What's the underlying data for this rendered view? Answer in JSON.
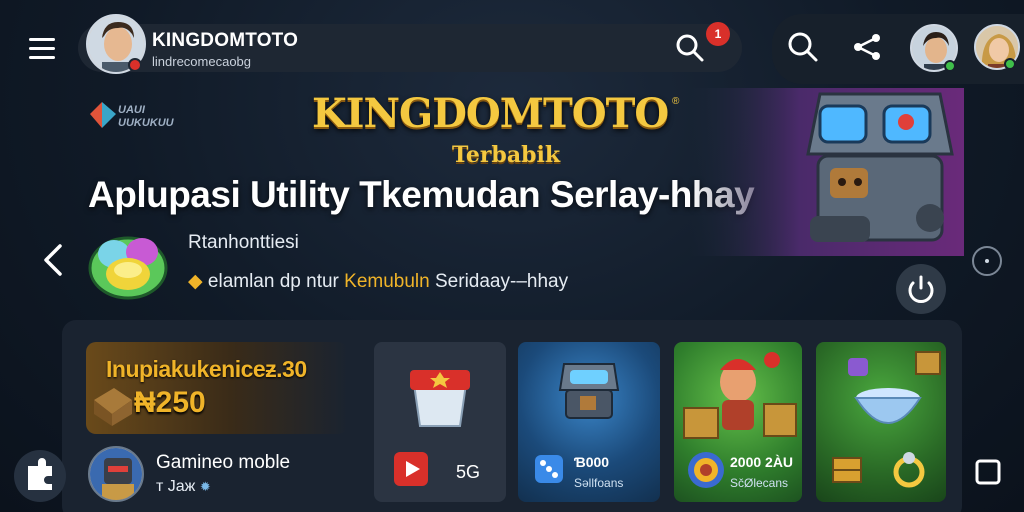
{
  "colors": {
    "accent_gold": "#f4c840",
    "highlight_orange": "#f0b429",
    "badge_red": "#d9302a",
    "online_green": "#3fbf4a"
  },
  "header": {
    "menu_icon": "hamburger-menu-icon",
    "brand_name": "KINGDOMTOTO",
    "brand_sub": "lindrecomecaobg",
    "search_icon": "search-icon",
    "notification_badge": "1",
    "right_search_icon": "search-icon",
    "share_icon": "share-icon"
  },
  "hero": {
    "logo_text": "UAUI UUKUKUU",
    "title": "KINGDOMTOTO",
    "title_mark": "®",
    "subtitle": "Terbabik",
    "headline": "Aplupasi Utility Tkemudan Serlay-hhay",
    "label": "Rtanhonttiesi",
    "desc_prefix": "elamlan dp ntur",
    "desc_highlight": "Kemubuln",
    "desc_suffix": "Seridaay-–hhay",
    "prev_icon": "chevron-left-icon",
    "next_icon": "carousel-indicator-icon",
    "power_icon": "refresh-icon"
  },
  "promo": {
    "line1": "Inupiakukeniceƶ.30",
    "line2": "₦250",
    "game_title": "Gamineo moble",
    "game_meta": "т Jaж"
  },
  "cards": [
    {
      "caption": "5G",
      "sub": ""
    },
    {
      "caption": "Ɓ000",
      "sub": "Səllfoans"
    },
    {
      "caption": "2000 2ÀU",
      "sub": "SčØlecans"
    },
    {
      "caption": "",
      "sub": ""
    }
  ],
  "side": {
    "left_icon": "puzzle-icon",
    "right_icon": "frame-icon"
  }
}
